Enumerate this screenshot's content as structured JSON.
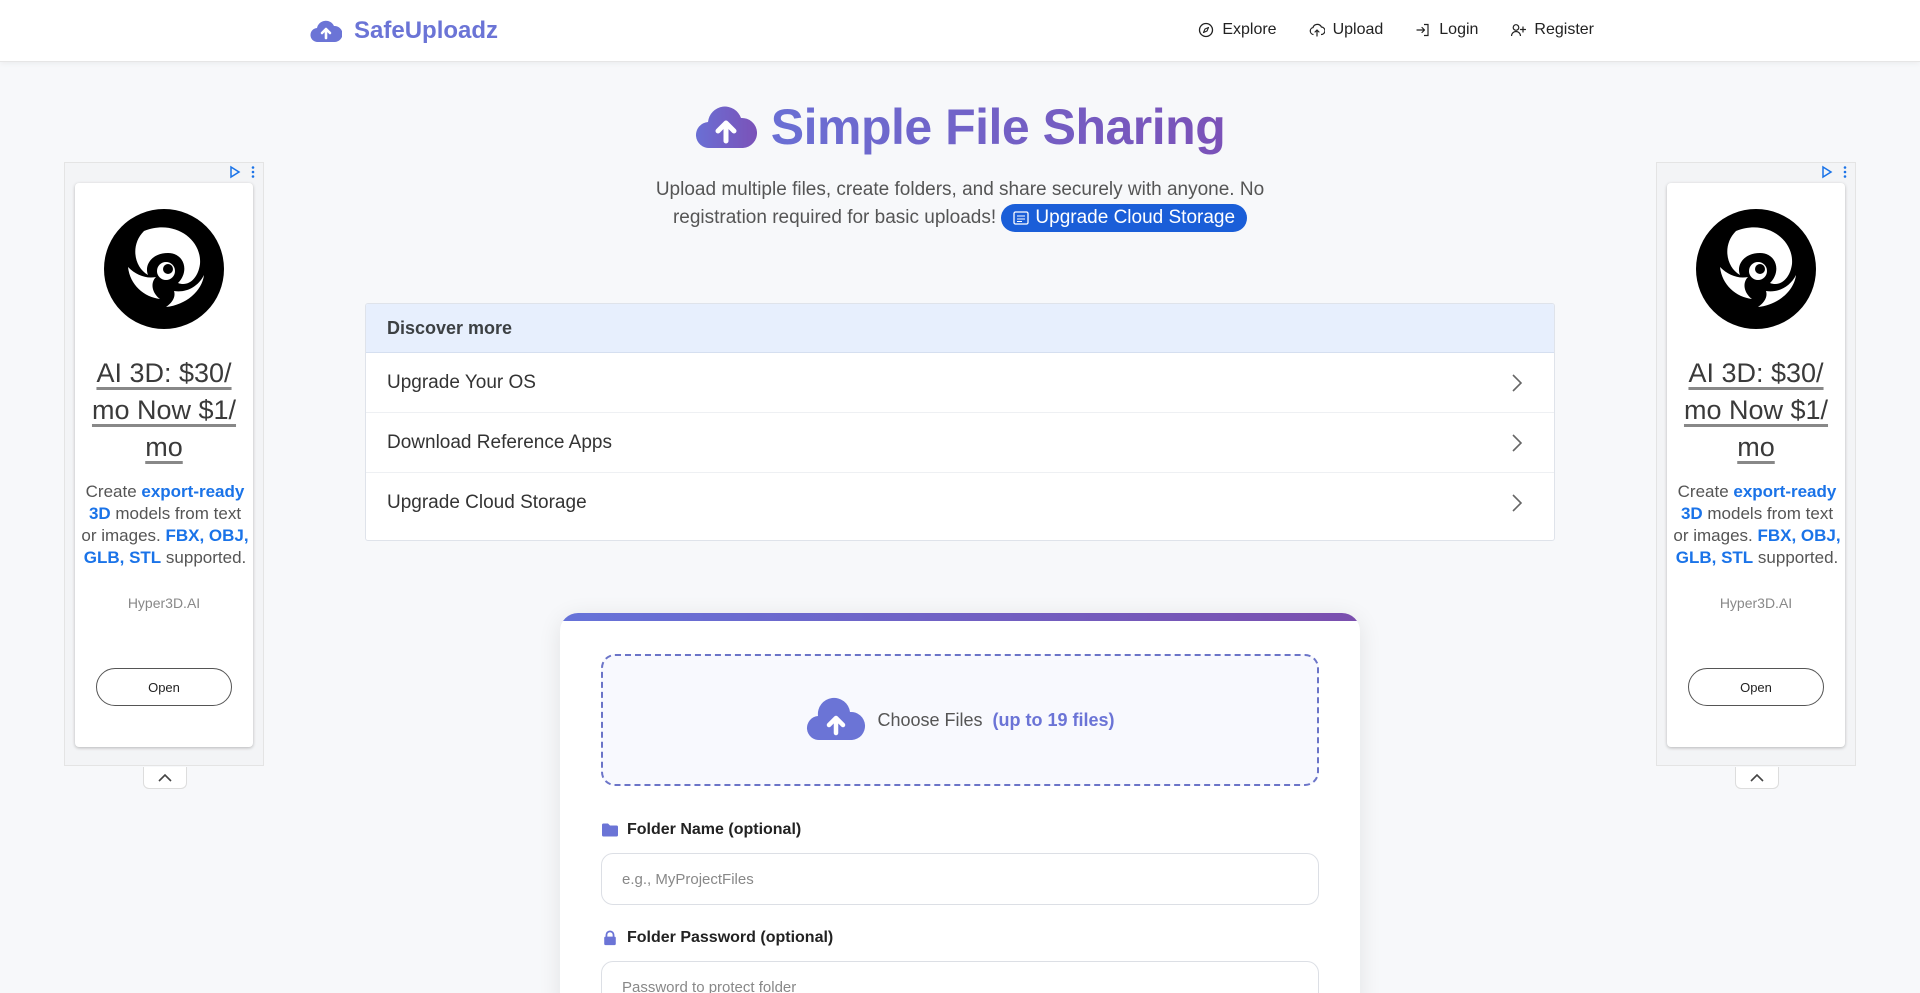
{
  "nav": {
    "brand": "SafeUploadz",
    "links": [
      {
        "label": "Explore",
        "icon": "compass-icon"
      },
      {
        "label": "Upload",
        "icon": "cloud-upload-icon"
      },
      {
        "label": "Login",
        "icon": "login-icon"
      },
      {
        "label": "Register",
        "icon": "user-plus-icon"
      }
    ]
  },
  "hero": {
    "title": "Simple File Sharing",
    "subtitle": "Upload multiple files, create folders, and share securely with anyone. No registration required for basic uploads!",
    "upgrade_label": "Upgrade Cloud Storage"
  },
  "discover": {
    "heading": "Discover more",
    "items": [
      "Upgrade Your OS",
      "Download Reference Apps",
      "Upgrade Cloud Storage"
    ]
  },
  "ad": {
    "headline": "AI 3D: $30/ mo Now $1/ mo",
    "body_parts": [
      "Create ",
      "export-ready 3D",
      " models from text or images. ",
      "FBX, OBJ, GLB, STL",
      " supported."
    ],
    "sponsor": "Hyper3D.AI",
    "cta": "Open"
  },
  "upload": {
    "choose_label": "Choose Files",
    "limit_label": "(up to 19 files)",
    "folder_label": "Folder Name (optional)",
    "folder_placeholder": "e.g., MyProjectFiles",
    "password_label": "Folder Password (optional)",
    "password_placeholder": "Password to protect folder"
  },
  "colors": {
    "brand": "#6b74d6",
    "accent_purple": "#7b52b8",
    "pill_blue": "#1a5ed8",
    "discover_header": "#e7effd"
  }
}
